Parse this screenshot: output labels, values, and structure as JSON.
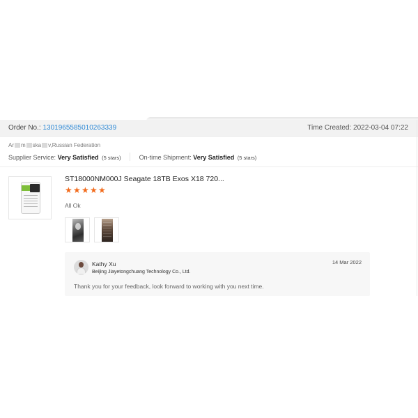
{
  "order": {
    "order_no_label": "Order No.:",
    "order_no": "1301965585010263339",
    "time_created_label": "Time Created:",
    "time_created": "2022-03-04 07:22"
  },
  "buyer": {
    "name_fragment_1": "Ar",
    "name_fragment_2": "m",
    "name_fragment_3": "ska",
    "name_fragment_4": "v,Russian Federation"
  },
  "ratings": {
    "supplier_label": "Supplier Service:",
    "supplier_value": "Very Satisfied",
    "supplier_stars": "(5 stars)",
    "shipment_label": "On-time Shipment:",
    "shipment_value": "Very Satisfied",
    "shipment_stars": "(5 stars)"
  },
  "product": {
    "title": "ST18000NM000J Seagate 18TB Exos X18 720...",
    "rating": 5,
    "review_text": "All Ok"
  },
  "reply": {
    "name": "Kathy Xu",
    "company": "Beijing Jiayetongchuang Technology Co., Ltd.",
    "date": "14 Mar 2022",
    "message": "Thank you for your feedback, look forward to working with you next time."
  },
  "colors": {
    "link_blue": "#2f8ad6",
    "star_orange": "#f26a1b",
    "header_bg": "#f2f2f2",
    "reply_bg": "#f7f7f7"
  }
}
